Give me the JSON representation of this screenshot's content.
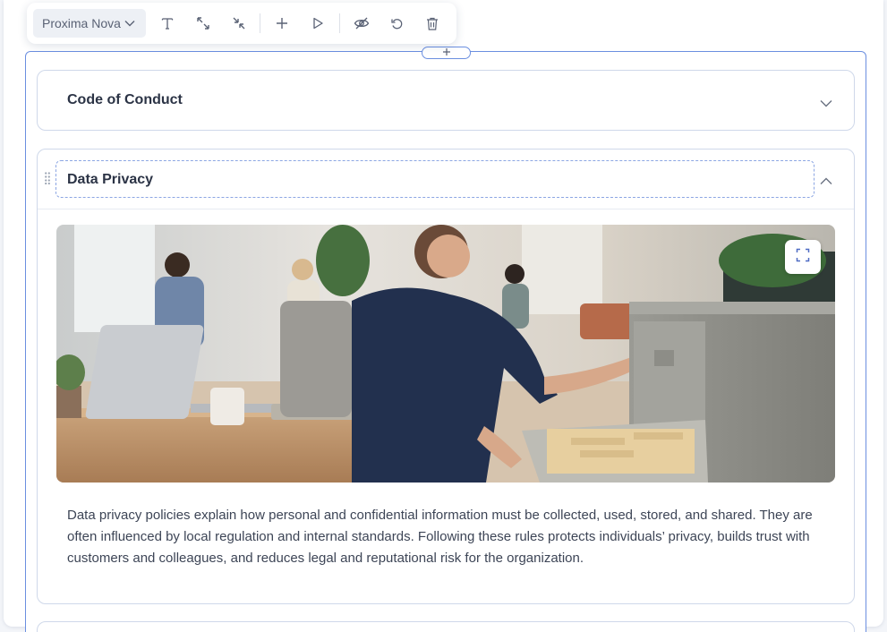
{
  "toolbar": {
    "font_name": "Proxima Nova",
    "icons": [
      "text-icon",
      "expand-icon",
      "collapse-icon",
      "plus-icon",
      "play-icon",
      "eye-off-icon",
      "undo-icon",
      "trash-icon"
    ]
  },
  "accordion": {
    "items": [
      {
        "title": "Code of Conduct",
        "state": "collapsed"
      },
      {
        "title": "Data Privacy",
        "state": "expanded",
        "body": "Data privacy policies explain how personal and confidential information must be collected, used, stored, and shared. They are often influenced by local regulation and internal standards. Following these rules protects individuals’ privacy, builds trust with customers and colleagues, and reduces legal and reputational risk for the organization."
      }
    ]
  },
  "colors": {
    "accent": "#6b8fe0",
    "border": "#cfd8ea",
    "text": "#2b3345"
  }
}
